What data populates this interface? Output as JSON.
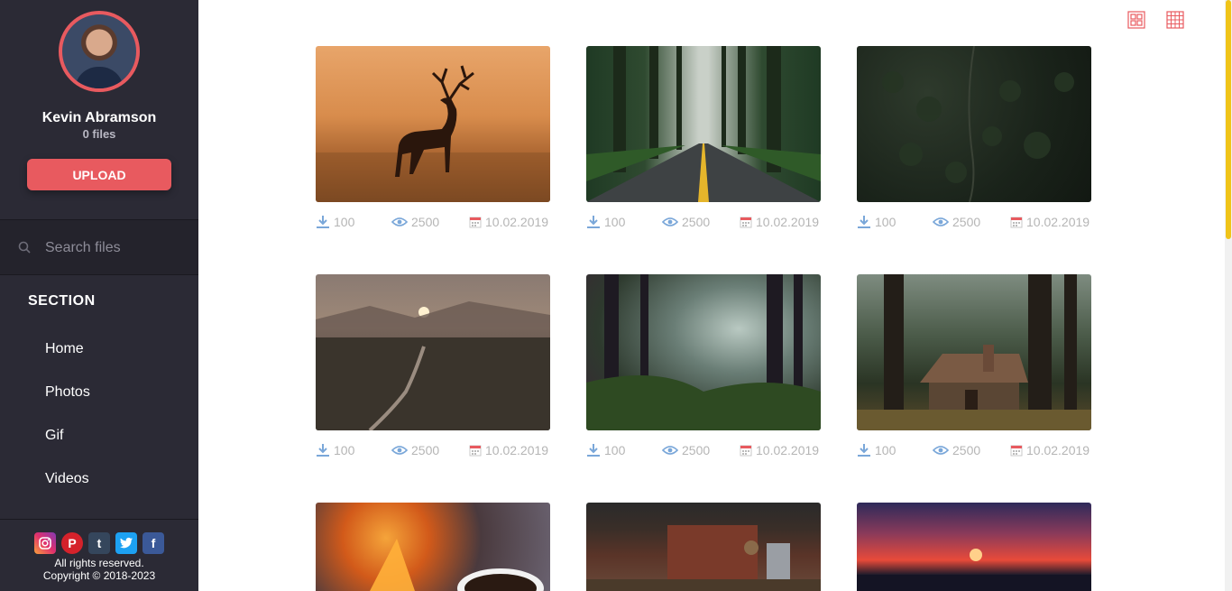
{
  "user": {
    "name": "Kevin Abramson",
    "files": "0 files"
  },
  "upload_label": "UPLOAD",
  "search": {
    "placeholder": "Search files"
  },
  "section_title": "SECTION",
  "nav": [
    {
      "label": "Home"
    },
    {
      "label": "Photos"
    },
    {
      "label": "Gif"
    },
    {
      "label": "Videos"
    }
  ],
  "socials": [
    "instagram-icon",
    "pinterest-icon",
    "tumblr-icon",
    "twitter-icon",
    "facebook-icon"
  ],
  "footer": {
    "rights": "All rights reserved.",
    "copyright": "Copyright © 2018-2023"
  },
  "view_toggles": [
    "grid-large-icon",
    "grid-small-icon"
  ],
  "colors": {
    "accent": "#e85a5f",
    "sidebar": "#2b2a35",
    "meta_icon": "#7aa7d9",
    "scroll_thumb": "#f0c419"
  },
  "cards": [
    {
      "image": "deer-sunset",
      "downloads": "100",
      "views": "2500",
      "date": "10.02.2019"
    },
    {
      "image": "forest-road",
      "downloads": "100",
      "views": "2500",
      "date": "10.02.2019"
    },
    {
      "image": "aerial-forest",
      "downloads": "100",
      "views": "2500",
      "date": "10.02.2019"
    },
    {
      "image": "valley-sunrise",
      "downloads": "100",
      "views": "2500",
      "date": "10.02.2019"
    },
    {
      "image": "misty-woods",
      "downloads": "100",
      "views": "2500",
      "date": "10.02.2019"
    },
    {
      "image": "forest-cabin",
      "downloads": "100",
      "views": "2500",
      "date": "10.02.2019"
    },
    {
      "image": "campfire-coffee",
      "downloads": "",
      "views": "",
      "date": ""
    },
    {
      "image": "brick-kitchen",
      "downloads": "",
      "views": "",
      "date": ""
    },
    {
      "image": "sea-sunset",
      "downloads": "",
      "views": "",
      "date": ""
    }
  ]
}
